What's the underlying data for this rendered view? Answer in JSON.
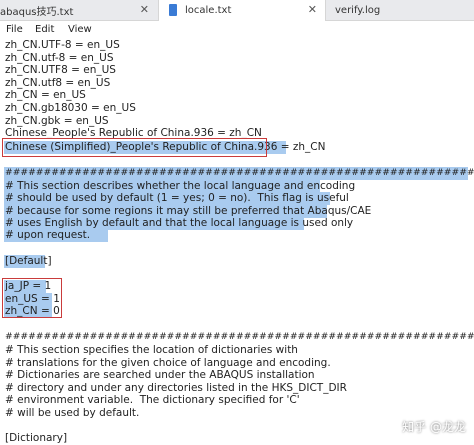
{
  "tabs": [
    {
      "label": "abaqus技巧.txt"
    },
    {
      "label": "locale.txt"
    },
    {
      "label": "verify.log"
    }
  ],
  "menu": [
    "File",
    "Edit",
    "View"
  ],
  "lines": [
    "zh_CN.UTF-8 = en_US",
    "zh_CN.utf-8 = en_US",
    "zh_CN.UTF8 = en_US",
    "zh_CN.utf8 = en_US",
    "zh_CN = en_US",
    "zh_CN.gb18030 = en_US",
    "zh_CN.gbk = en_US",
    "Chinese_People's Republic of China.936 = zh_CN",
    "Chinese (Simplified)_People's Republic of China.936 = zh_CN",
    "",
    "###################################################################",
    "# This section describes whether the local language and encoding",
    "# should be used by default (1 = yes; 0 = no).  This flag is useful",
    "# because for some regions it may still be preferred that Abaqus/CAE",
    "# uses English by default and that the local language is used only",
    "# upon request.",
    "",
    "[Default]",
    "",
    "ja_JP = 1",
    "en_US = 1",
    "zh_CN = 0",
    "",
    "###################################################################",
    "# This section specifies the location of dictionaries with",
    "# translations for the given choice of language and encoding.",
    "# Dictionaries are searched under the ABAQUS installation",
    "# directory and under any directories listed in the HKS_DICT_DIR",
    "# environment variable.  The dictionary specified for 'C'",
    "# will be used by default.",
    "",
    "[Dictionary]"
  ],
  "watermark": "知乎 @龙龙"
}
